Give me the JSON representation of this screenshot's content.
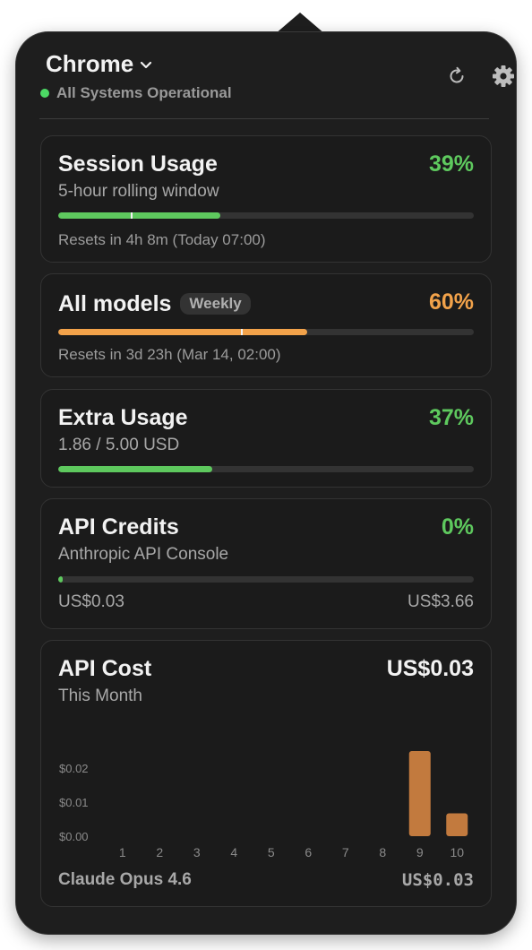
{
  "header": {
    "title": "Chrome",
    "status": "All Systems Operational",
    "refresh_icon": "refresh-icon",
    "settings_icon": "gear-icon"
  },
  "session": {
    "title": "Session Usage",
    "subtitle": "5-hour rolling window",
    "percent_label": "39%",
    "percent": 39,
    "marker_percent": 17.5,
    "reset": "Resets in 4h 8m (Today 07:00)"
  },
  "models": {
    "title": "All models",
    "badge": "Weekly",
    "percent_label": "60%",
    "percent": 60,
    "marker_percent": 44,
    "reset": "Resets in 3d 23h (Mar 14, 02:00)"
  },
  "extra": {
    "title": "Extra Usage",
    "subtitle": "1.86 / 5.00 USD",
    "percent_label": "37%",
    "percent": 37
  },
  "credits": {
    "title": "API Credits",
    "subtitle": "Anthropic API Console",
    "percent_label": "0%",
    "percent": 1,
    "used": "US$0.03",
    "total": "US$3.66"
  },
  "cost": {
    "title": "API Cost",
    "subtitle": "This Month",
    "total": "US$0.03",
    "model": "Claude Opus 4.6",
    "model_cost": "US$0.03"
  },
  "colors": {
    "green": "#5ec95e",
    "orange": "#f2a24a",
    "bar": "#c27a3e"
  },
  "chart_data": {
    "type": "bar",
    "categories": [
      "1",
      "2",
      "3",
      "4",
      "5",
      "6",
      "7",
      "8",
      "9",
      "10"
    ],
    "values": [
      0,
      0,
      0,
      0,
      0,
      0,
      0,
      0,
      0.025,
      0.0067
    ],
    "yticks": [
      "$0.00",
      "$0.01",
      "$0.02"
    ],
    "ylim": [
      0,
      0.03
    ],
    "grid": false
  }
}
